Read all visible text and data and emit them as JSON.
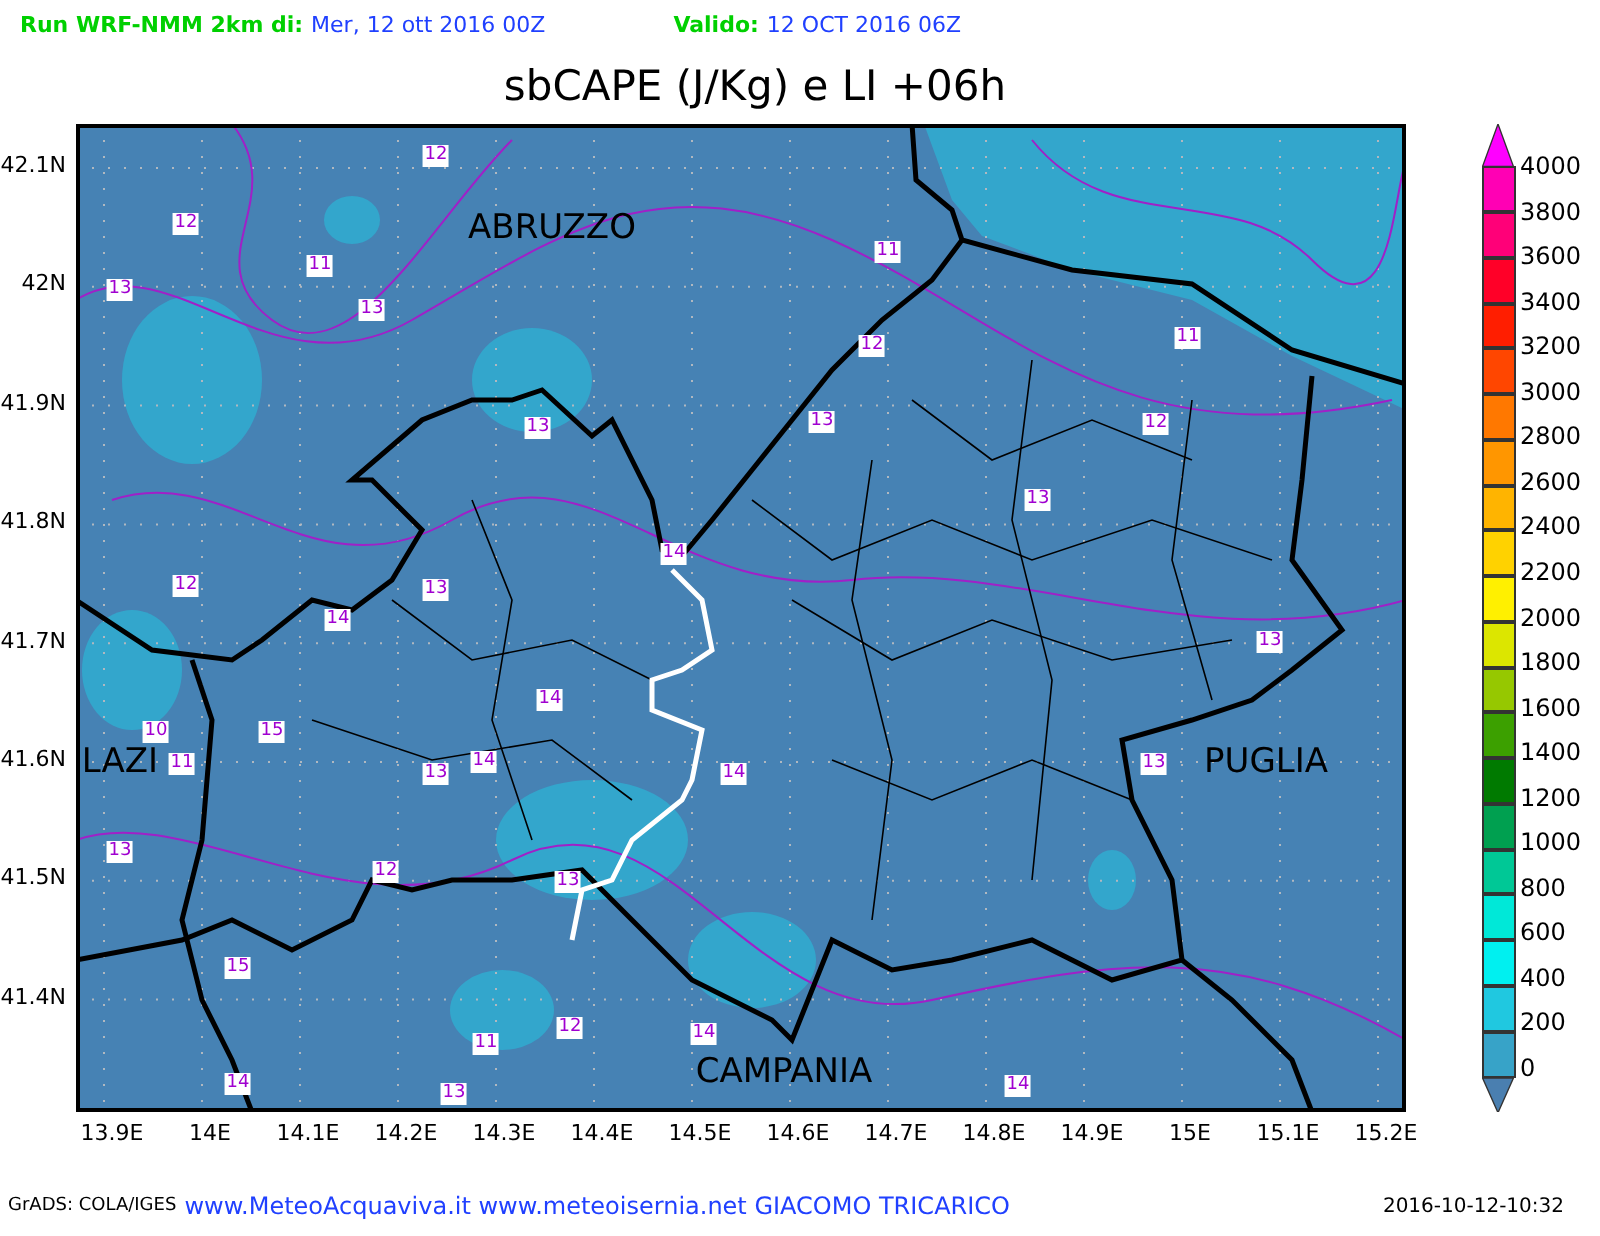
{
  "header": {
    "run_label": "Run WRF-NMM 2km di:",
    "run_date": "Mer, 12 ott 2016 00Z",
    "valid_label": "Valido:",
    "valid_date": "12 OCT 2016 06Z"
  },
  "title": "sbCAPE (J/Kg) e LI +06h",
  "map": {
    "latitude_labels": [
      "42.1N",
      "42N",
      "41.9N",
      "41.8N",
      "41.7N",
      "41.6N",
      "41.5N",
      "41.4N"
    ],
    "longitude_labels": [
      "13.9E",
      "14E",
      "14.1E",
      "14.2E",
      "14.3E",
      "14.4E",
      "14.5E",
      "14.6E",
      "14.7E",
      "14.8E",
      "14.9E",
      "15E",
      "15.1E",
      "15.2E"
    ],
    "region_labels": [
      "ABRUZZO",
      "LAZI",
      "PUGLIA",
      "CAMPANIA"
    ],
    "contour_labels": [
      "12",
      "12",
      "11",
      "13",
      "13",
      "11",
      "12",
      "11",
      "13",
      "13",
      "12",
      "13",
      "14",
      "12",
      "13",
      "14",
      "13",
      "14",
      "10",
      "15",
      "11",
      "13",
      "14",
      "14",
      "13",
      "13",
      "12",
      "13",
      "15",
      "11",
      "12",
      "14",
      "14",
      "13",
      "14"
    ]
  },
  "colorbar": {
    "segments": [
      {
        "kind": "arrow",
        "color": "#ff00ff"
      },
      {
        "kind": "band",
        "color": "#ff00b4"
      },
      {
        "kind": "band",
        "color": "#ff0078"
      },
      {
        "kind": "band",
        "color": "#ff0028"
      },
      {
        "kind": "band",
        "color": "#ff1e00"
      },
      {
        "kind": "band",
        "color": "#ff4600"
      },
      {
        "kind": "band",
        "color": "#ff7800"
      },
      {
        "kind": "band",
        "color": "#ff9600"
      },
      {
        "kind": "band",
        "color": "#ffb400"
      },
      {
        "kind": "band",
        "color": "#ffd200"
      },
      {
        "kind": "band",
        "color": "#fff000"
      },
      {
        "kind": "band",
        "color": "#dce600"
      },
      {
        "kind": "band",
        "color": "#96c800"
      },
      {
        "kind": "band",
        "color": "#3ca000"
      },
      {
        "kind": "band",
        "color": "#007a00"
      },
      {
        "kind": "band",
        "color": "#00a050"
      },
      {
        "kind": "band",
        "color": "#00c896"
      },
      {
        "kind": "band",
        "color": "#00e8d8"
      },
      {
        "kind": "band",
        "color": "#00f0f0"
      },
      {
        "kind": "band",
        "color": "#20c8e0"
      },
      {
        "kind": "band",
        "color": "#37a3c8"
      },
      {
        "kind": "arrow",
        "color": "#4a7fb0"
      }
    ],
    "labels": [
      "4000",
      "3800",
      "3600",
      "3400",
      "3200",
      "3000",
      "2800",
      "2600",
      "2400",
      "2200",
      "2000",
      "1800",
      "1600",
      "1400",
      "1200",
      "1000",
      "800",
      "600",
      "400",
      "200",
      "0"
    ]
  },
  "footer": {
    "software": "GrADS: COLA/IGES",
    "credits": "www.MeteoAcquaviva.it www.meteoisernia.net GIACOMO TRICARICO",
    "timestamp": "2016-10-12-10:32"
  }
}
